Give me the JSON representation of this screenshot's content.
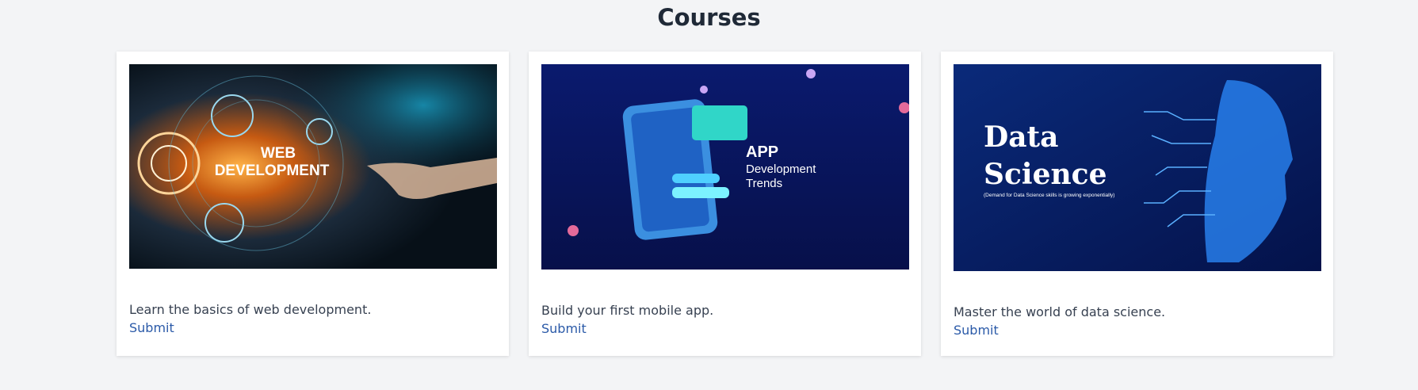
{
  "page": {
    "title": "Courses"
  },
  "courses": [
    {
      "image": {
        "heading_line1": "WEB",
        "heading_line2": "DEVELOPMENT"
      },
      "description": "Learn the basics of web development.",
      "action": "Submit"
    },
    {
      "image": {
        "heading": "APP",
        "line1": "Development",
        "line2": "Trends"
      },
      "description": "Build your first mobile app.",
      "action": "Submit"
    },
    {
      "image": {
        "line1": "Data",
        "line2": "Science",
        "caption": "(Demand for Data Science skills is growing exponentially)"
      },
      "description": "Master the world of data science.",
      "action": "Submit"
    }
  ]
}
